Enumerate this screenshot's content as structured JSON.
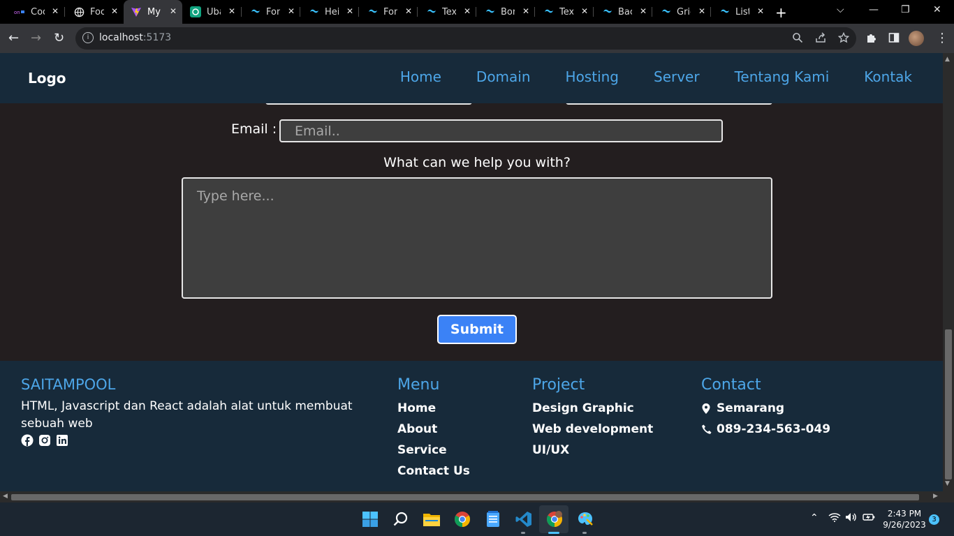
{
  "browser": {
    "tabs": [
      {
        "title": "Cod",
        "icon": "codepen-icon"
      },
      {
        "title": "Foo",
        "icon": "globe-icon"
      },
      {
        "title": "My",
        "icon": "vite-icon",
        "active": true
      },
      {
        "title": "Uba",
        "icon": "chatgpt-icon"
      },
      {
        "title": "Fon",
        "icon": "tailwind-icon"
      },
      {
        "title": "Hei",
        "icon": "tailwind-icon"
      },
      {
        "title": "Fon",
        "icon": "tailwind-icon"
      },
      {
        "title": "Text",
        "icon": "tailwind-icon"
      },
      {
        "title": "Bor",
        "icon": "tailwind-icon"
      },
      {
        "title": "Text",
        "icon": "tailwind-icon"
      },
      {
        "title": "Bac",
        "icon": "tailwind-icon"
      },
      {
        "title": "Grid",
        "icon": "tailwind-icon"
      },
      {
        "title": "List",
        "icon": "tailwind-icon"
      }
    ],
    "url_host": "localhost",
    "url_port": ":5173"
  },
  "site": {
    "logo": "Logo",
    "nav": [
      "Home",
      "Domain",
      "Hosting",
      "Server",
      "Tentang Kami",
      "Kontak"
    ]
  },
  "form": {
    "email_label": "Email :",
    "email_placeholder": "Email..",
    "help_label": "What can we help you with?",
    "message_placeholder": "Type here...",
    "submit_label": "Submit"
  },
  "footer": {
    "brand": "SAITAMPOOL",
    "tagline": "HTML, Javascript dan React adalah alat untuk membuat sebuah web",
    "socials": [
      "facebook-icon",
      "instagram-icon",
      "linkedin-icon"
    ],
    "menu": {
      "title": "Menu",
      "items": [
        "Home",
        "About",
        "Service",
        "Contact Us"
      ]
    },
    "project": {
      "title": "Project",
      "items": [
        "Design Graphic",
        "Web development",
        "UI/UX"
      ]
    },
    "contact": {
      "title": "Contact",
      "location": "Semarang",
      "phone": "089-234-563-049"
    }
  },
  "taskbar": {
    "time": "2:43 PM",
    "date": "9/26/2023",
    "notifications": "3"
  },
  "colors": {
    "accent": "#4da6e8",
    "nav_bg": "#172a3a",
    "page_bg": "#231e1f",
    "button": "#3b82f6"
  }
}
